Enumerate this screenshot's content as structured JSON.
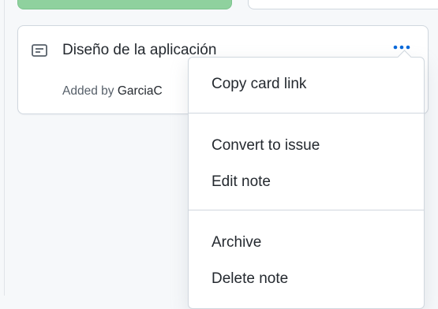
{
  "card": {
    "icon": "note-icon",
    "title": "Diseño de la aplicación",
    "added_by_prefix": "Added by",
    "added_by_user": "GarciaC",
    "more_icon": "kebab-horizontal-icon",
    "accent_color": "#0969da"
  },
  "menu": {
    "copy_link": "Copy card link",
    "convert_to_issue": "Convert to issue",
    "edit_note": "Edit note",
    "archive": "Archive",
    "delete_note": "Delete note"
  },
  "colors": {
    "top_card_green": "#8fd19e",
    "border": "#d0d7de",
    "background": "#f6f8fa"
  }
}
